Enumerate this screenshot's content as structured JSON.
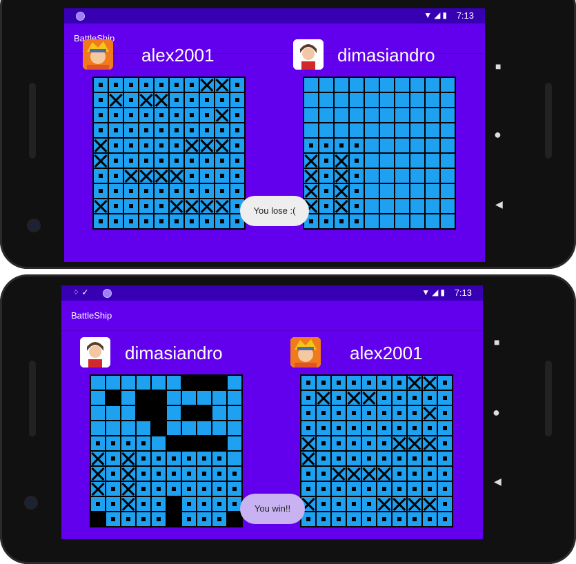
{
  "top": {
    "status": {
      "time": "7:13",
      "icons": "▼◢▮"
    },
    "appbar": {
      "title": "BattleShip"
    },
    "player1": {
      "name": "alex2001"
    },
    "player2": {
      "name": "dimasiandro"
    },
    "toast": {
      "text": "You lose :(",
      "bg": "#eeeeee"
    },
    "board1": [
      "DDDDDDDXXD",
      "DXDXXDDDDD",
      "DDDDDDDDXD",
      "DDDDDDDDDD",
      "XDDDDDXXXD",
      "XDDDDDDDDD",
      "DDXXXXDDDD",
      "DDDDDDDDDD",
      "XDDDDXXXXD",
      "DDDDDDDDDD"
    ],
    "board2": [
      "..........",
      "..........",
      "..........",
      "..........",
      "DDDD......",
      "XDXD......",
      "XDXD......",
      "XDXD......",
      "XDXD......",
      "DDDD......"
    ]
  },
  "bottom": {
    "status": {
      "time": "7:13",
      "icons": "▼◢▮",
      "left_icons": "⁘ ✓"
    },
    "appbar": {
      "title": "BattleShip"
    },
    "player1": {
      "name": "dimasiandro"
    },
    "player2": {
      "name": "alex2001"
    },
    "toast": {
      "text": "You win!!",
      "bg": "#c9b2f2"
    },
    "board1": [
      "......SSS.",
      ".S.SS.....",
      "...SS.SS..",
      "....S.....",
      "DDDD.SSSS.",
      "XDXDDDDDD.",
      "XDXDDDDDDD",
      "XDXDDDDDDD",
      "DDXDDSDDDD",
      "SDDDDSDDDS"
    ],
    "board2": [
      "DDDDDDDXXD",
      "DXDXXDDDDD",
      "DDDDDDDDXD",
      "DDDDDDDDDD",
      "XDDDDDXXXD",
      "XDDDDDDDDD",
      "DDXXXXDDDD",
      "DDDDDDDDDD",
      "XDDDDXXXXD",
      "DDDDDDDDDD"
    ]
  }
}
